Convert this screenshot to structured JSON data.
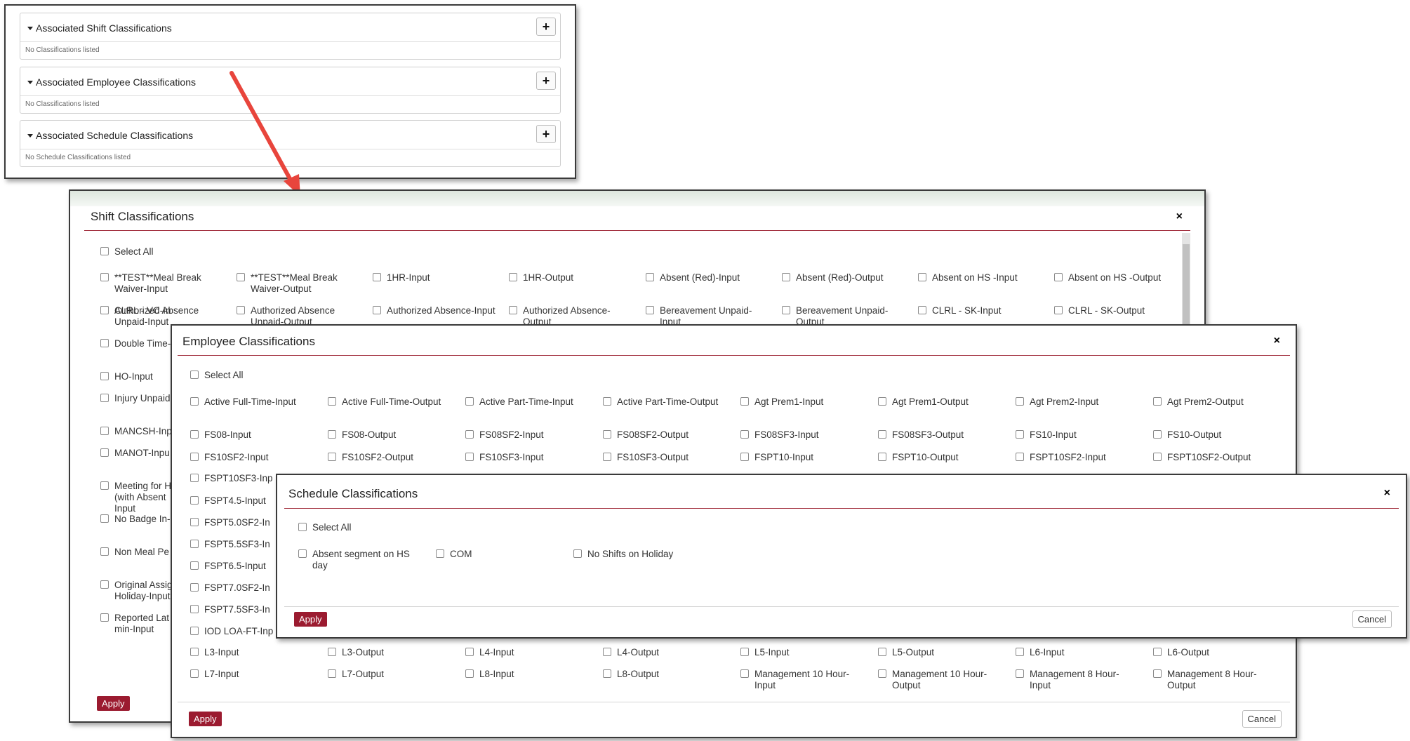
{
  "top_panel": {
    "sections": [
      {
        "title": "Associated Shift Classifications",
        "empty_text": "No Classifications listed",
        "add": "+"
      },
      {
        "title": "Associated Employee Classifications",
        "empty_text": "No Classifications listed",
        "add": "+"
      },
      {
        "title": "Associated Schedule Classifications",
        "empty_text": "No Schedule Classifications listed",
        "add": "+"
      }
    ]
  },
  "shift_modal": {
    "title": "Shift Classifications",
    "close": "×",
    "select_all": "Select All",
    "items": [
      "**TEST**Meal Break Waiver-Input",
      "**TEST**Meal Break Waiver-Output",
      "1HR-Input",
      "1HR-Output",
      "Absent (Red)-Input",
      "Absent (Red)-Output",
      "Absent on HS -Input",
      "Absent on HS -Output",
      "Authorized Absence Unpaid-Input",
      "Authorized Absence Unpaid-Output",
      "Authorized Absence-Input",
      "Authorized Absence-Output",
      "Bereavement Unpaid-Input",
      "Bereavement Unpaid-Output",
      "CLRL - SK-Input",
      "CLRL - SK-Output"
    ],
    "partial_items": [
      "CLRL - VC-In",
      "Double Time-",
      "HO-Input",
      "Injury Unpaid",
      "MANCSH-Inp",
      "MANOT-Inpu",
      "Meeting for H (with Absent Input",
      "No Badge In-",
      "Non Meal Pe",
      "Original Assig Holiday-Input",
      "Reported Lat min-Input"
    ],
    "apply": "Apply"
  },
  "employee_modal": {
    "title": "Employee Classifications",
    "close": "×",
    "select_all": "Select All",
    "rows": [
      [
        "Active Full-Time-Input",
        "Active Full-Time-Output",
        "Active Part-Time-Input",
        "Active Part-Time-Output",
        "Agt Prem1-Input",
        "Agt Prem1-Output",
        "Agt Prem2-Input",
        "Agt Prem2-Output"
      ],
      [
        "FS08-Input",
        "FS08-Output",
        "FS08SF2-Input",
        "FS08SF2-Output",
        "FS08SF3-Input",
        "FS08SF3-Output",
        "FS10-Input",
        "FS10-Output"
      ],
      [
        "FS10SF2-Input",
        "FS10SF2-Output",
        "FS10SF3-Input",
        "FS10SF3-Output",
        "FSPT10-Input",
        "FSPT10-Output",
        "FSPT10SF2-Input",
        "FSPT10SF2-Output"
      ]
    ],
    "partial_items": [
      "FSPT10SF3-Inp",
      "FSPT4.5-Input",
      "FSPT5.0SF2-In",
      "FSPT5.5SF3-In",
      "FSPT6.5-Input",
      "FSPT7.0SF2-In",
      "FSPT7.5SF3-In",
      "IOD LOA-FT-Inp"
    ],
    "bottom_rows": [
      [
        "L3-Input",
        "L3-Output",
        "L4-Input",
        "L4-Output",
        "L5-Input",
        "L5-Output",
        "L6-Input",
        "L6-Output"
      ],
      [
        "L7-Input",
        "L7-Output",
        "L8-Input",
        "L8-Output",
        "Management 10 Hour-Input",
        "Management 10 Hour-Output",
        "Management 8 Hour-Input",
        "Management 8 Hour-Output"
      ]
    ],
    "apply": "Apply",
    "cancel": "Cancel"
  },
  "schedule_modal": {
    "title": "Schedule Classifications",
    "close": "×",
    "select_all": "Select All",
    "items": [
      "Absent segment on HS day",
      "COM",
      "No Shifts on Holiday"
    ],
    "apply": "Apply",
    "cancel": "Cancel"
  },
  "colors": {
    "accent": "#9b1b30",
    "arrow": "#e8453c"
  }
}
